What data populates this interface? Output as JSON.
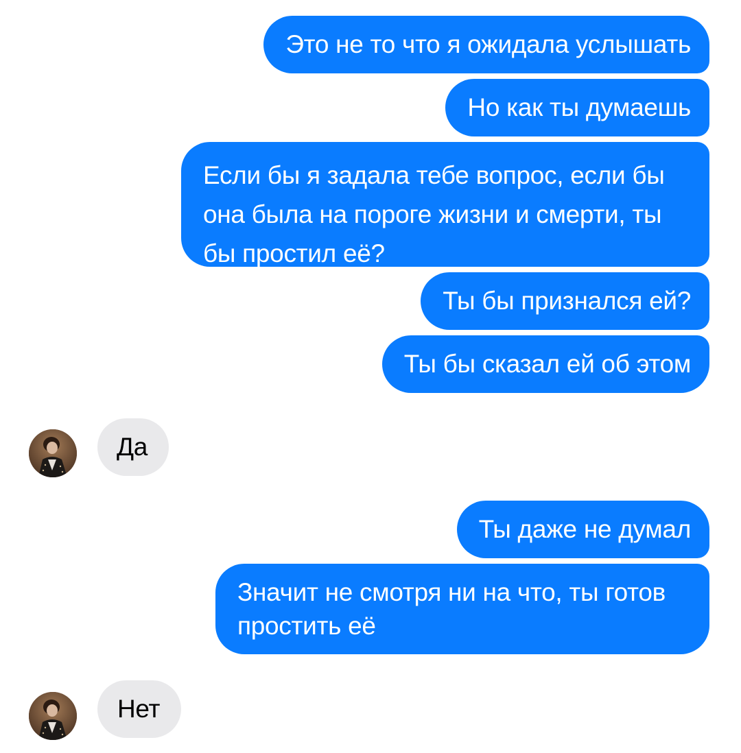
{
  "colors": {
    "outgoing_bubble": "#0A7CFF",
    "outgoing_text": "#FFFFFF",
    "incoming_bubble": "#E9E9EB",
    "incoming_text": "#000000",
    "background": "#FFFFFF"
  },
  "messages": [
    {
      "direction": "outgoing",
      "text": "Это не то что я ожидала услышать"
    },
    {
      "direction": "outgoing",
      "text": "Но как ты думаешь"
    },
    {
      "direction": "outgoing",
      "lines": [
        "Если бы я задала тебе вопрос, если бы",
        "она была на пороге жизни и смерти, ты",
        "бы простил её?"
      ]
    },
    {
      "direction": "outgoing",
      "text": "Ты бы признался ей?"
    },
    {
      "direction": "outgoing",
      "text": "Ты бы сказал ей об этом"
    },
    {
      "direction": "incoming",
      "text": "Да",
      "avatar": "contact-avatar"
    },
    {
      "direction": "outgoing",
      "text": "Ты даже не думал"
    },
    {
      "direction": "outgoing",
      "lines": [
        "Значит не смотря ни на что, ты готов",
        "простить её"
      ]
    },
    {
      "direction": "incoming",
      "text": "Нет",
      "avatar": "contact-avatar"
    }
  ]
}
